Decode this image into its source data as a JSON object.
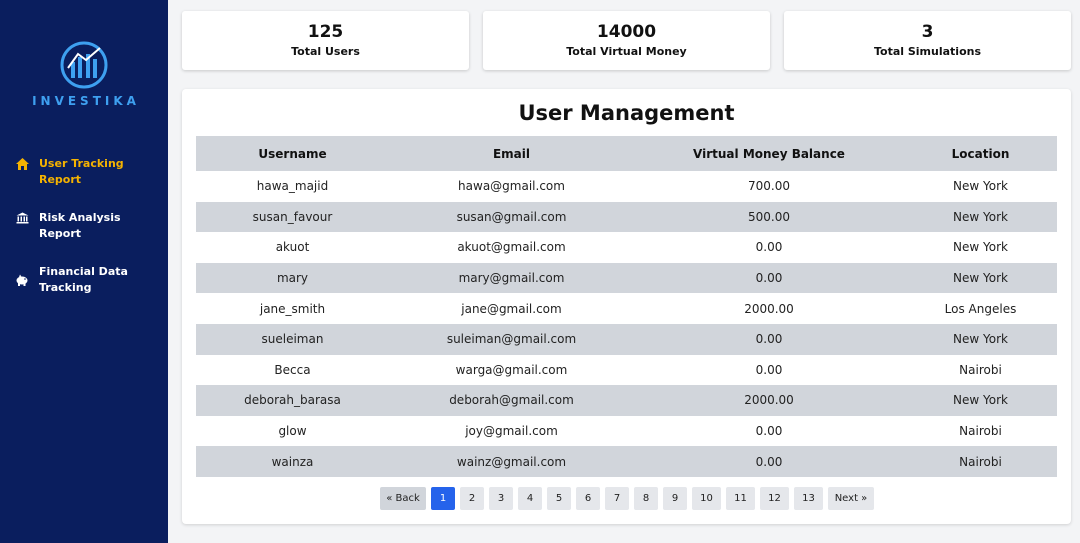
{
  "brand": {
    "name": "INVESTIKA"
  },
  "sidebar": {
    "items": [
      {
        "label": "User Tracking Report",
        "icon": "home-icon",
        "active": true
      },
      {
        "label": "Risk Analysis Report",
        "icon": "bank-icon",
        "active": false
      },
      {
        "label": "Financial Data Tracking",
        "icon": "piggy-bank-icon",
        "active": false
      }
    ]
  },
  "stats": [
    {
      "value": "125",
      "label": "Total Users"
    },
    {
      "value": "14000",
      "label": "Total Virtual Money"
    },
    {
      "value": "3",
      "label": "Total Simulations"
    }
  ],
  "table": {
    "title": "User Management",
    "columns": [
      "Username",
      "Email",
      "Virtual Money Balance",
      "Location"
    ],
    "rows": [
      [
        "hawa_majid",
        "hawa@gmail.com",
        "700.00",
        "New York"
      ],
      [
        "susan_favour",
        "susan@gmail.com",
        "500.00",
        "New York"
      ],
      [
        "akuot",
        "akuot@gmail.com",
        "0.00",
        "New York"
      ],
      [
        "mary",
        "mary@gmail.com",
        "0.00",
        "New York"
      ],
      [
        "jane_smith",
        "jane@gmail.com",
        "2000.00",
        "Los Angeles"
      ],
      [
        "sueleiman",
        "suleiman@gmail.com",
        "0.00",
        "New York"
      ],
      [
        "Becca",
        "warga@gmail.com",
        "0.00",
        "Nairobi"
      ],
      [
        "deborah_barasa",
        "deborah@gmail.com",
        "2000.00",
        "New York"
      ],
      [
        "glow",
        "joy@gmail.com",
        "0.00",
        "Nairobi"
      ],
      [
        "wainza",
        "wainz@gmail.com",
        "0.00",
        "Nairobi"
      ]
    ]
  },
  "pagination": {
    "back_label": "« Back",
    "next_label": "Next »",
    "pages": [
      "1",
      "2",
      "3",
      "4",
      "5",
      "6",
      "7",
      "8",
      "9",
      "10",
      "11",
      "12",
      "13"
    ],
    "current": "1"
  },
  "colors": {
    "sidebar_bg": "#0a1e5e",
    "active_nav": "#f5b301",
    "accent": "#2563eb",
    "logo": "#3ea0f0"
  }
}
